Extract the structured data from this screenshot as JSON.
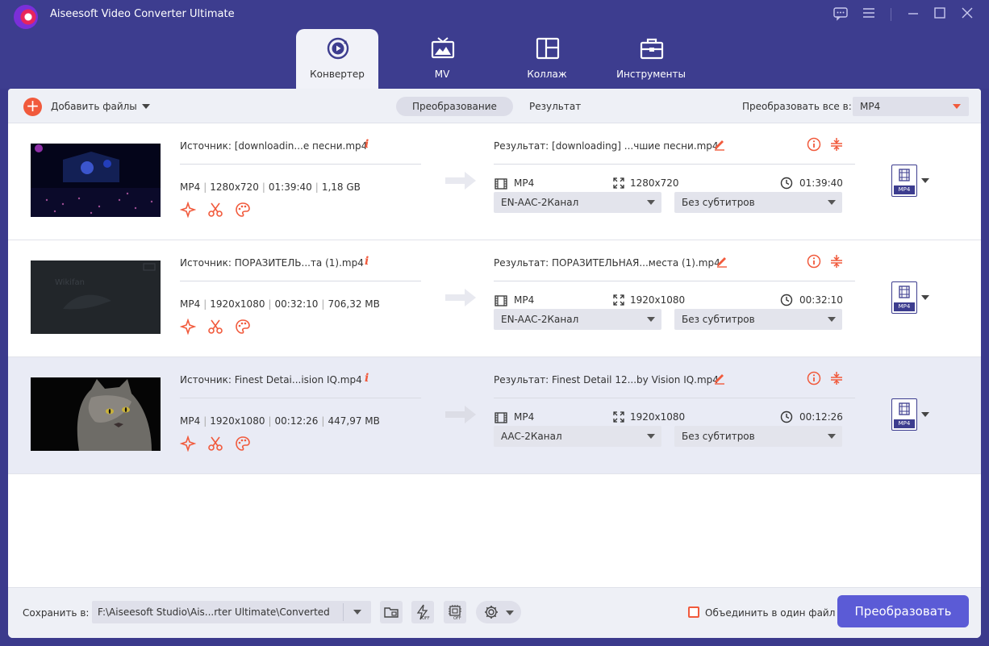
{
  "app": {
    "title": "Aiseesoft Video Converter Ultimate"
  },
  "nav": {
    "tabs": [
      {
        "label": "Конвертер",
        "icon": "converter-icon",
        "active": true
      },
      {
        "label": "MV",
        "icon": "tv-icon",
        "active": false
      },
      {
        "label": "Коллаж",
        "icon": "collage-icon",
        "active": false
      },
      {
        "label": "Инструменты",
        "icon": "toolbox-icon",
        "active": false
      }
    ]
  },
  "toolbar": {
    "add_files_label": "Добавить файлы",
    "tab_convert": "Преобразование",
    "tab_result": "Результат",
    "convert_all_label": "Преобразовать все в:",
    "convert_all_value": "MP4"
  },
  "files": [
    {
      "source_name": "Источник: [downloadin...е песни.mp4",
      "source_meta": [
        "MP4",
        "1280x720",
        "01:39:40",
        "1,18 GB"
      ],
      "result_name": "Результат: [downloading] ...чшие песни.mp4",
      "result_format": "MP4",
      "result_resolution": "1280x720",
      "result_duration": "01:39:40",
      "audio_track": "EN-AAC-2Канал",
      "subtitle": "Без субтитров",
      "format_badge": "MP4",
      "selected": false
    },
    {
      "source_name": "Источник: ПОРАЗИТЕЛЬ...та (1).mp4",
      "source_meta": [
        "MP4",
        "1920x1080",
        "00:32:10",
        "706,32 MB"
      ],
      "result_name": "Результат: ПОРАЗИТЕЛЬНАЯ...места (1).mp4",
      "result_format": "MP4",
      "result_resolution": "1920x1080",
      "result_duration": "00:32:10",
      "audio_track": "EN-AAC-2Канал",
      "subtitle": "Без субтитров",
      "format_badge": "MP4",
      "selected": false
    },
    {
      "source_name": "Источник: Finest Detai...ision IQ.mp4",
      "source_meta": [
        "MP4",
        "1920x1080",
        "00:12:26",
        "447,97 MB"
      ],
      "result_name": "Результат: Finest Detail 12...by Vision IQ.mp4",
      "result_format": "MP4",
      "result_resolution": "1920x1080",
      "result_duration": "00:12:26",
      "audio_track": "AAC-2Канал",
      "subtitle": "Без субтитров",
      "format_badge": "MP4",
      "selected": true
    }
  ],
  "footer": {
    "save_label": "Сохранить в:",
    "save_path": "F:\\Aiseesoft Studio\\Ais...rter Ultimate\\Converted",
    "merge_label": "Объединить в один файл",
    "convert_button": "Преобразовать"
  },
  "colors": {
    "titlebar": "#3d3d8f",
    "accent": "#f15a3c",
    "primary_button": "#5b5bd6"
  }
}
